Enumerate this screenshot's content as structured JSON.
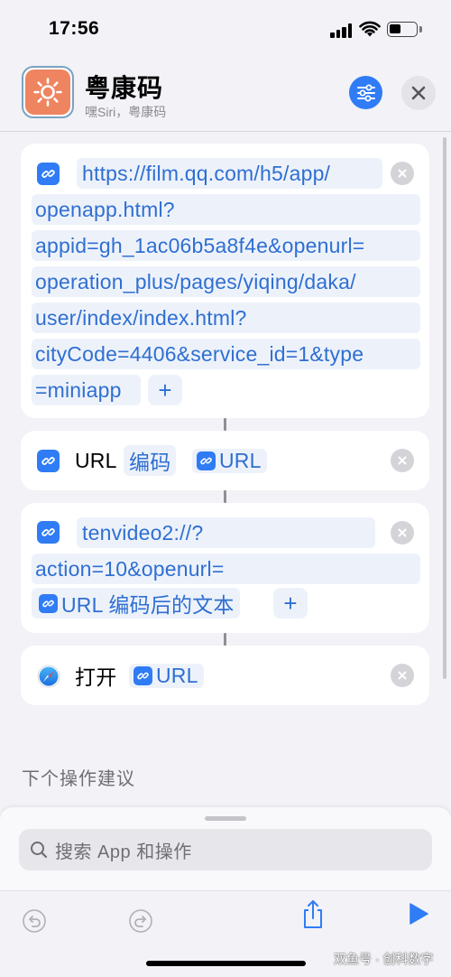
{
  "status_bar": {
    "time": "17:56"
  },
  "header": {
    "title": "粤康码",
    "subtitle": "嘿Siri，粤康码",
    "icon": "sun-icon",
    "settings_icon": "sliders-icon",
    "close_icon": "close-icon"
  },
  "actions": [
    {
      "type": "text",
      "lines": [
        "https://film.qq.com/h5/app/",
        "openapp.html?",
        "appid=gh_1ac06b5a8f4e&openurl=",
        "operation_plus/pages/yiqing/daka/",
        "user/index/index.html?",
        "cityCode=4406&service_id=1&type",
        "=miniapp"
      ]
    },
    {
      "type": "url-encode",
      "label": "URL",
      "mode": "编码",
      "input": "URL"
    },
    {
      "type": "text",
      "lines": [
        "tenvideo2://?",
        "action=10&openurl="
      ],
      "variable": "URL 编码后的文本"
    },
    {
      "type": "open",
      "label": "打开",
      "input": "URL"
    }
  ],
  "suggestions": {
    "title": "下个操作建议"
  },
  "search": {
    "placeholder": "搜索 App 和操作"
  },
  "watermark": "双鱼号 · 创科数字",
  "colors": {
    "accent": "#2f7cf6",
    "token_text": "#2f6fd2",
    "app_icon": "#ee8460"
  }
}
